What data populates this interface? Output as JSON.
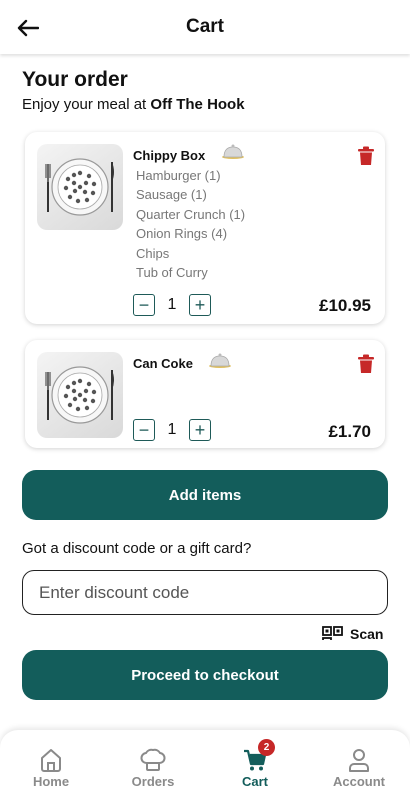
{
  "header": {
    "title": "Cart"
  },
  "order": {
    "title": "Your order",
    "subtitle_prefix": "Enjoy your meal at",
    "restaurant": "Off The Hook"
  },
  "items": [
    {
      "name": "Chippy Box",
      "options": [
        "Hamburger (1)",
        "Sausage (1)",
        "Quarter Crunch (1)",
        "Onion Rings (4)",
        "Chips",
        "Tub of Curry"
      ],
      "quantity": "1",
      "price": "£10.95"
    },
    {
      "name": "Can Coke",
      "options": [],
      "quantity": "1",
      "price": "£1.70"
    }
  ],
  "buttons": {
    "add_items": "Add items",
    "checkout": "Proceed to checkout",
    "qty_minus": "−",
    "qty_plus": "+"
  },
  "discount": {
    "label": "Got a discount code or a gift card?",
    "placeholder": "Enter discount code",
    "scan_label": "Scan"
  },
  "nav": {
    "items": [
      {
        "label": "Home",
        "icon": "home-icon"
      },
      {
        "label": "Orders",
        "icon": "chef-hat-icon"
      },
      {
        "label": "Cart",
        "icon": "cart-icon",
        "badge": "2",
        "active": true
      },
      {
        "label": "Account",
        "icon": "person-icon"
      }
    ]
  },
  "colors": {
    "primary": "#135d5b",
    "delete": "#c62828",
    "badge": "#c62828",
    "inactive_nav": "#8a8a8a"
  }
}
